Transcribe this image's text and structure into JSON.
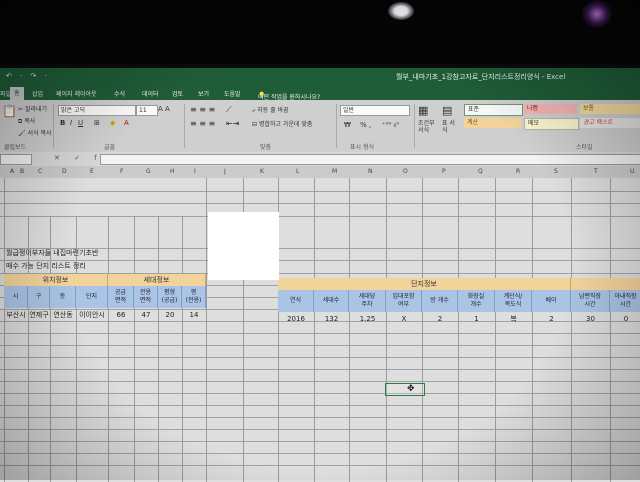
{
  "window": {
    "title": "월부_내마기초_1강참고자료_단지리스트정리양식 - Excel",
    "quick_access": "↶ · ↷ ·"
  },
  "ribbon_tabs": [
    "파일",
    "홈",
    "삽입",
    "페이지 레이아웃",
    "수식",
    "데이터",
    "검토",
    "보기",
    "도움말"
  ],
  "tell_me": "어떤 작업을 원하시나요?",
  "ribbon": {
    "clipboard": {
      "cut": "잘라내기",
      "copy": "복사",
      "format_painter": "서식 복사",
      "group": "클립보드"
    },
    "font": {
      "name": "맑은 고딕",
      "size": "11",
      "group": "글꼴"
    },
    "alignment": {
      "wrap": "자동 줄 바꿈",
      "merge": "병합하고 가운데 맞춤",
      "group": "맞춤"
    },
    "number": {
      "format": "일반",
      "group": "표시 형식",
      "percent": "% ,"
    },
    "styles": {
      "conditional": "조건부 서식",
      "table": "표 서식",
      "normal": "표준",
      "bad": "나쁨",
      "good": "보통",
      "calc": "계산",
      "memo": "메모",
      "warn": "경고 텍스트",
      "group": "스타일"
    }
  },
  "formula_bar": {
    "fx": "✕ ✓ fx"
  },
  "columns": [
    "A",
    "B",
    "C",
    "D",
    "E",
    "F",
    "G",
    "H",
    "I",
    "J",
    "K",
    "L",
    "M",
    "N",
    "O",
    "P",
    "Q",
    "R",
    "S",
    "T",
    "U"
  ],
  "sheet": {
    "title1": "월급쟁이부자들 내집마련기초반",
    "title2": "매수 가능 단지 리스트 정리",
    "location_header": "위치정보",
    "household_header": "세대정보",
    "complex_header": "단지정보",
    "location_cols": [
      "시",
      "구",
      "동",
      "단지"
    ],
    "household_cols": [
      "공급\n면적",
      "전용\n면적",
      "평형\n(공급)",
      "평\n(전용)"
    ],
    "complex_cols": [
      "연식",
      "세대수",
      "세대당\n주차",
      "임대포함\n여부",
      "방 개수",
      "화장실\n개수",
      "계단식/\n복도식",
      "베이",
      "남편직장\n시간",
      "아내직장\n시간"
    ],
    "location_vals": [
      "부산시",
      "연제구",
      "연산동",
      "이이안시"
    ],
    "household_vals": [
      "66",
      "47",
      "20",
      "14"
    ],
    "complex_vals": [
      "2016",
      "132",
      "1.25",
      "X",
      "2",
      "1",
      "복",
      "2",
      "30",
      "0"
    ]
  },
  "colors": {
    "ribbon_green": "#1f5d38",
    "header_orange": "#f2d39a",
    "header_blue": "#a9c4e4"
  }
}
